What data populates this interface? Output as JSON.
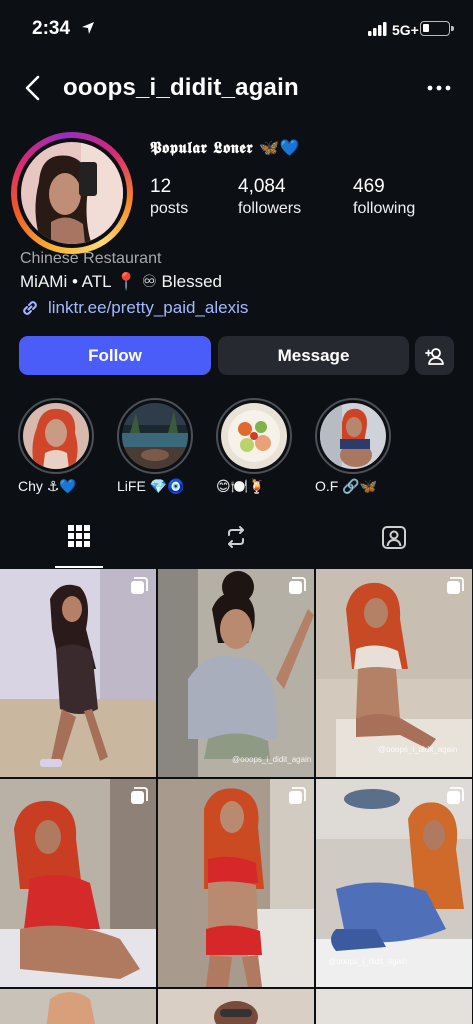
{
  "status_bar": {
    "time": "2:34",
    "network": "5G+"
  },
  "header": {
    "username": "ooops_i_didit_again"
  },
  "profile": {
    "display_name": "𝕻𝖔𝖕𝖚𝖑𝖆𝖗 𝕷𝖔𝖓𝖊𝖗 🦋💙",
    "stats": [
      {
        "value": "12",
        "label": "posts"
      },
      {
        "value": "4,084",
        "label": "followers"
      },
      {
        "value": "469",
        "label": "following"
      }
    ],
    "category": "Chinese Restaurant",
    "bio": "MiAMi • ATL 📍 ♾ Blessed",
    "link": "linktr.ee/pretty_paid_alexis"
  },
  "actions": {
    "follow": "Follow",
    "message": "Message"
  },
  "highlights": [
    {
      "label": "Chy ⚓💙"
    },
    {
      "label": "LiFE 💎🧿"
    },
    {
      "label": "😊🍽️🍹"
    },
    {
      "label": "O.F 🔗🦋"
    }
  ],
  "posts": [
    {
      "caption": ""
    },
    {
      "caption": "@ooops_i_didit_again"
    },
    {
      "caption": "@ooops_i_didit_again"
    },
    {
      "caption": ""
    },
    {
      "caption": ""
    },
    {
      "caption": "@ooops_i_didit_again"
    }
  ],
  "colors": {
    "background": "#0c1014",
    "follow": "#4a5df9",
    "secondary_button": "#262a30",
    "link": "#a5b8ff"
  }
}
